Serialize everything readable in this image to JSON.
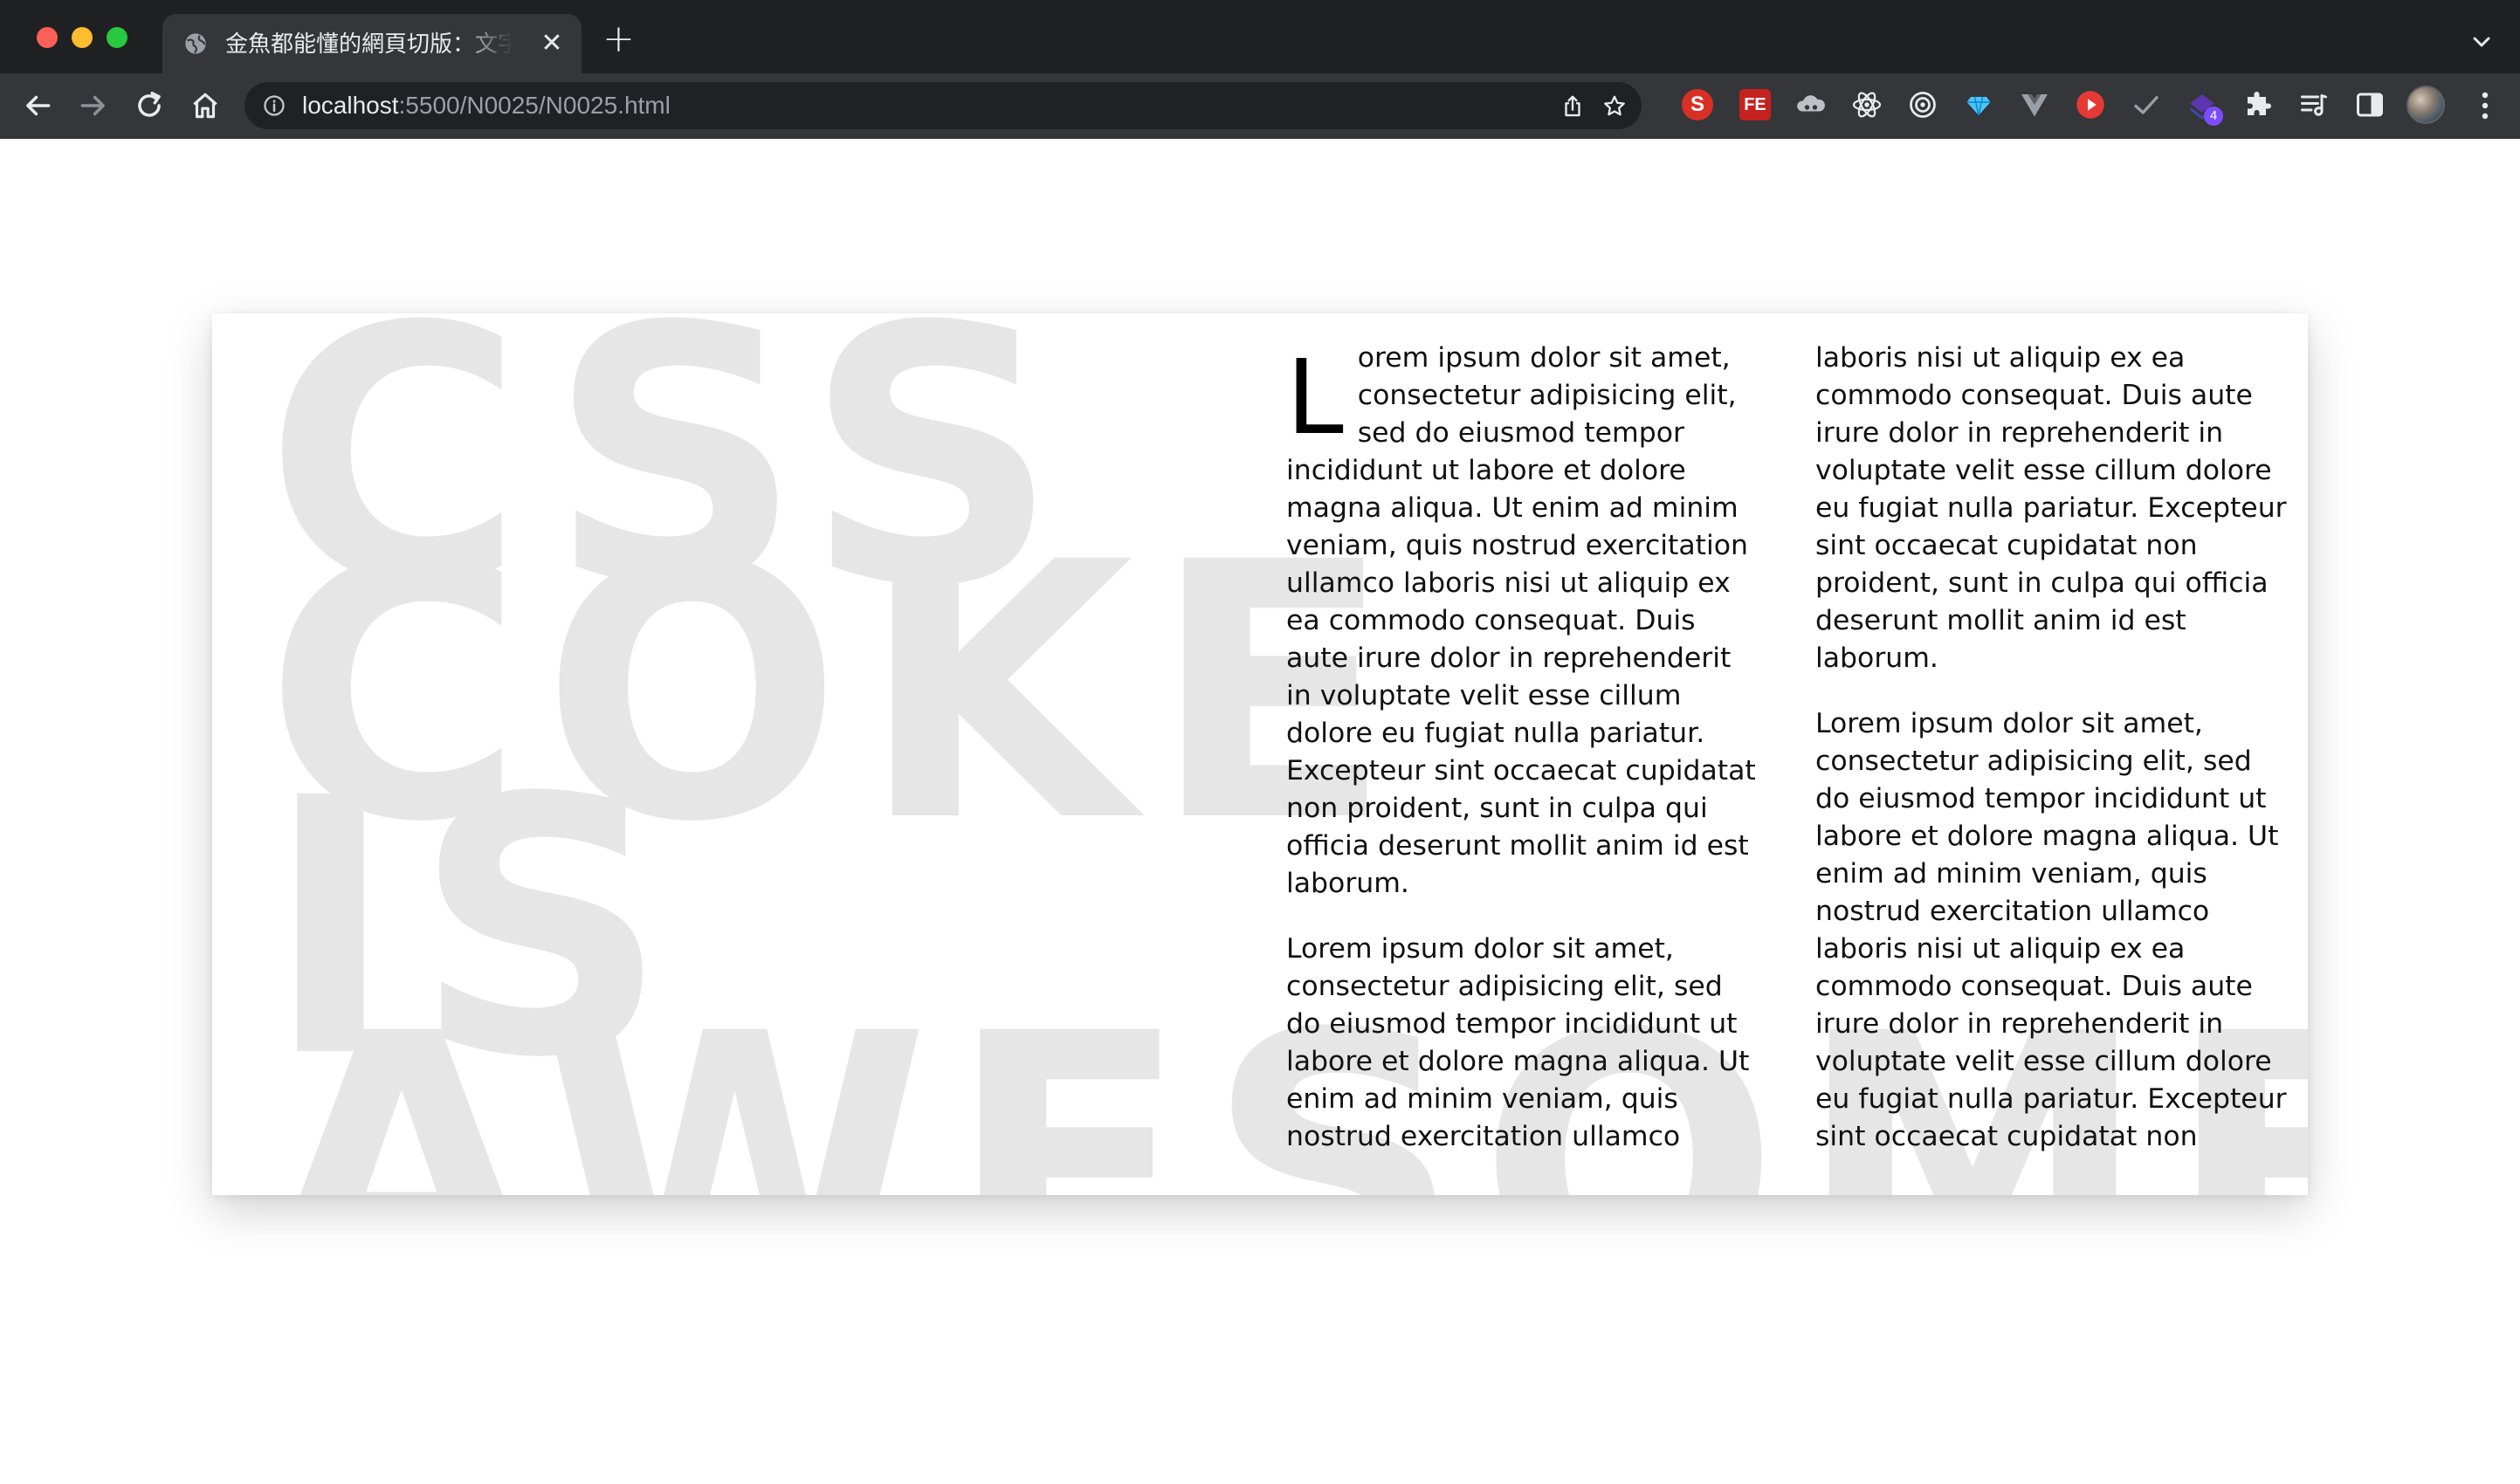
{
  "browser": {
    "tab": {
      "title": "金魚都能懂的網頁切版：文字排版",
      "close_glyph": "✕"
    },
    "new_tab_glyph": "+",
    "address": {
      "host": "localhost",
      "path": ":5500/N0025/N0025.html"
    },
    "extensions": {
      "s_label": "S",
      "fe_label": "FE",
      "badge_count": "4"
    },
    "icons": {
      "favicon": "globe-icon",
      "info": "info-icon",
      "share": "share-icon",
      "bookmark": "star-icon"
    }
  },
  "page": {
    "background_text": "CSS COKE\nIS\nAWESOME",
    "article": {
      "dropcap": "L",
      "paragraphs": [
        "orem ipsum dolor sit amet, consectetur adipisicing elit, sed do eiusmod tempor incididunt ut labore et dolore magna aliqua. Ut enim ad minim veniam, quis nostrud exercitation ullamco laboris nisi ut aliquip ex ea commodo consequat. Duis aute irure dolor in reprehenderit in voluptate velit esse cillum dolore eu fugiat nulla pariatur. Excepteur sint occaecat cupidatat non proident, sunt in culpa qui officia deserunt mollit anim id est laborum.",
        "Lorem ipsum dolor sit amet, consectetur adipisicing elit, sed do eiusmod tempor incididunt ut labore et dolore magna aliqua. Ut enim ad minim veniam, quis nostrud exercitation ullamco laboris nisi ut aliquip ex ea commodo consequat. Duis aute irure dolor in reprehenderit in voluptate velit esse cillum dolore eu fugiat nulla pariatur. Excepteur sint occaecat cupidatat non proident, sunt in culpa qui officia deserunt mollit anim id est laborum.",
        "Lorem ipsum dolor sit amet, consectetur adipisicing elit, sed do eiusmod tempor incididunt ut labore et dolore magna aliqua. Ut enim ad minim veniam, quis nostrud exercitation ullamco laboris nisi ut aliquip ex ea commodo consequat. Duis aute irure dolor in reprehenderit in voluptate velit esse cillum dolore eu fugiat nulla pariatur. Excepteur sint occaecat cupidatat non proident, sunt in culpa qui officia deserunt mollit anim id est laborum."
      ]
    }
  },
  "colors": {
    "chrome_dark": "#1f2022",
    "chrome_toolbar": "#35363a",
    "background_text": "#e6e6e6",
    "body_text": "#111111"
  }
}
